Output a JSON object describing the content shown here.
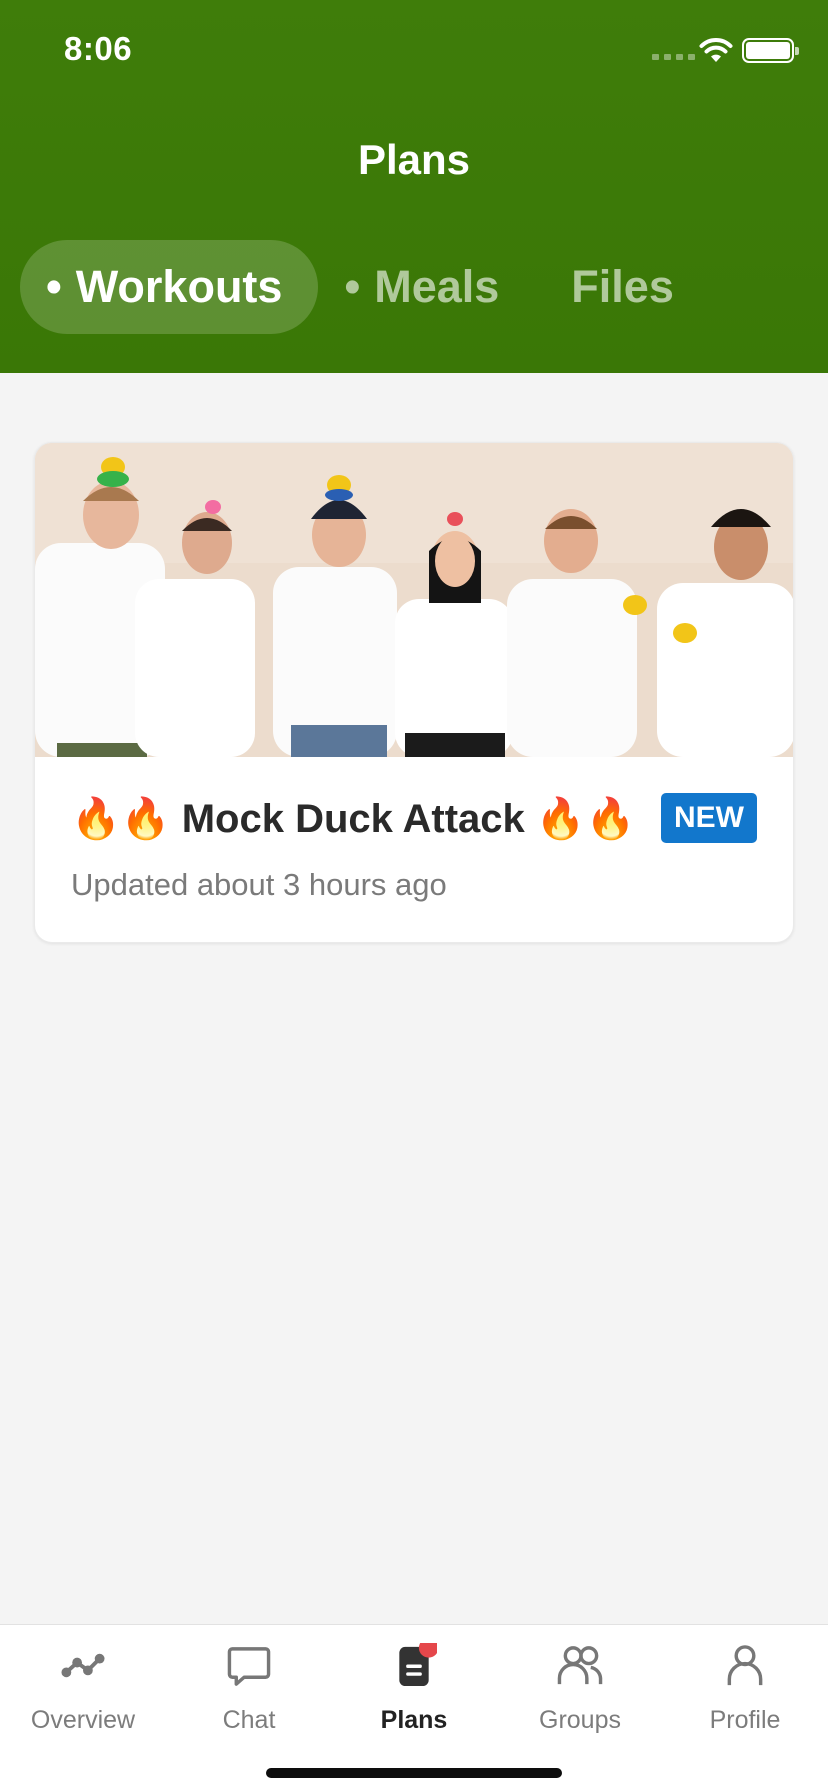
{
  "status_bar": {
    "time": "8:06"
  },
  "header": {
    "title": "Plans"
  },
  "tabs": [
    {
      "label": "Workouts",
      "dot": "•"
    },
    {
      "label": "Meals",
      "dot": "•"
    },
    {
      "label": "Files"
    }
  ],
  "plan_card": {
    "title": "🔥🔥 Mock Duck Attack 🔥🔥",
    "updated": "Updated about 3 hours ago",
    "badge": "NEW"
  },
  "bottom_nav": [
    {
      "label": "Overview",
      "icon": "overview-icon"
    },
    {
      "label": "Chat",
      "icon": "chat-icon"
    },
    {
      "label": "Plans",
      "icon": "plans-icon"
    },
    {
      "label": "Groups",
      "icon": "groups-icon"
    },
    {
      "label": "Profile",
      "icon": "profile-icon"
    }
  ],
  "colors": {
    "brand_green": "#3f7d0a",
    "badge_blue": "#1277cc",
    "notification_red": "#e5474b"
  }
}
